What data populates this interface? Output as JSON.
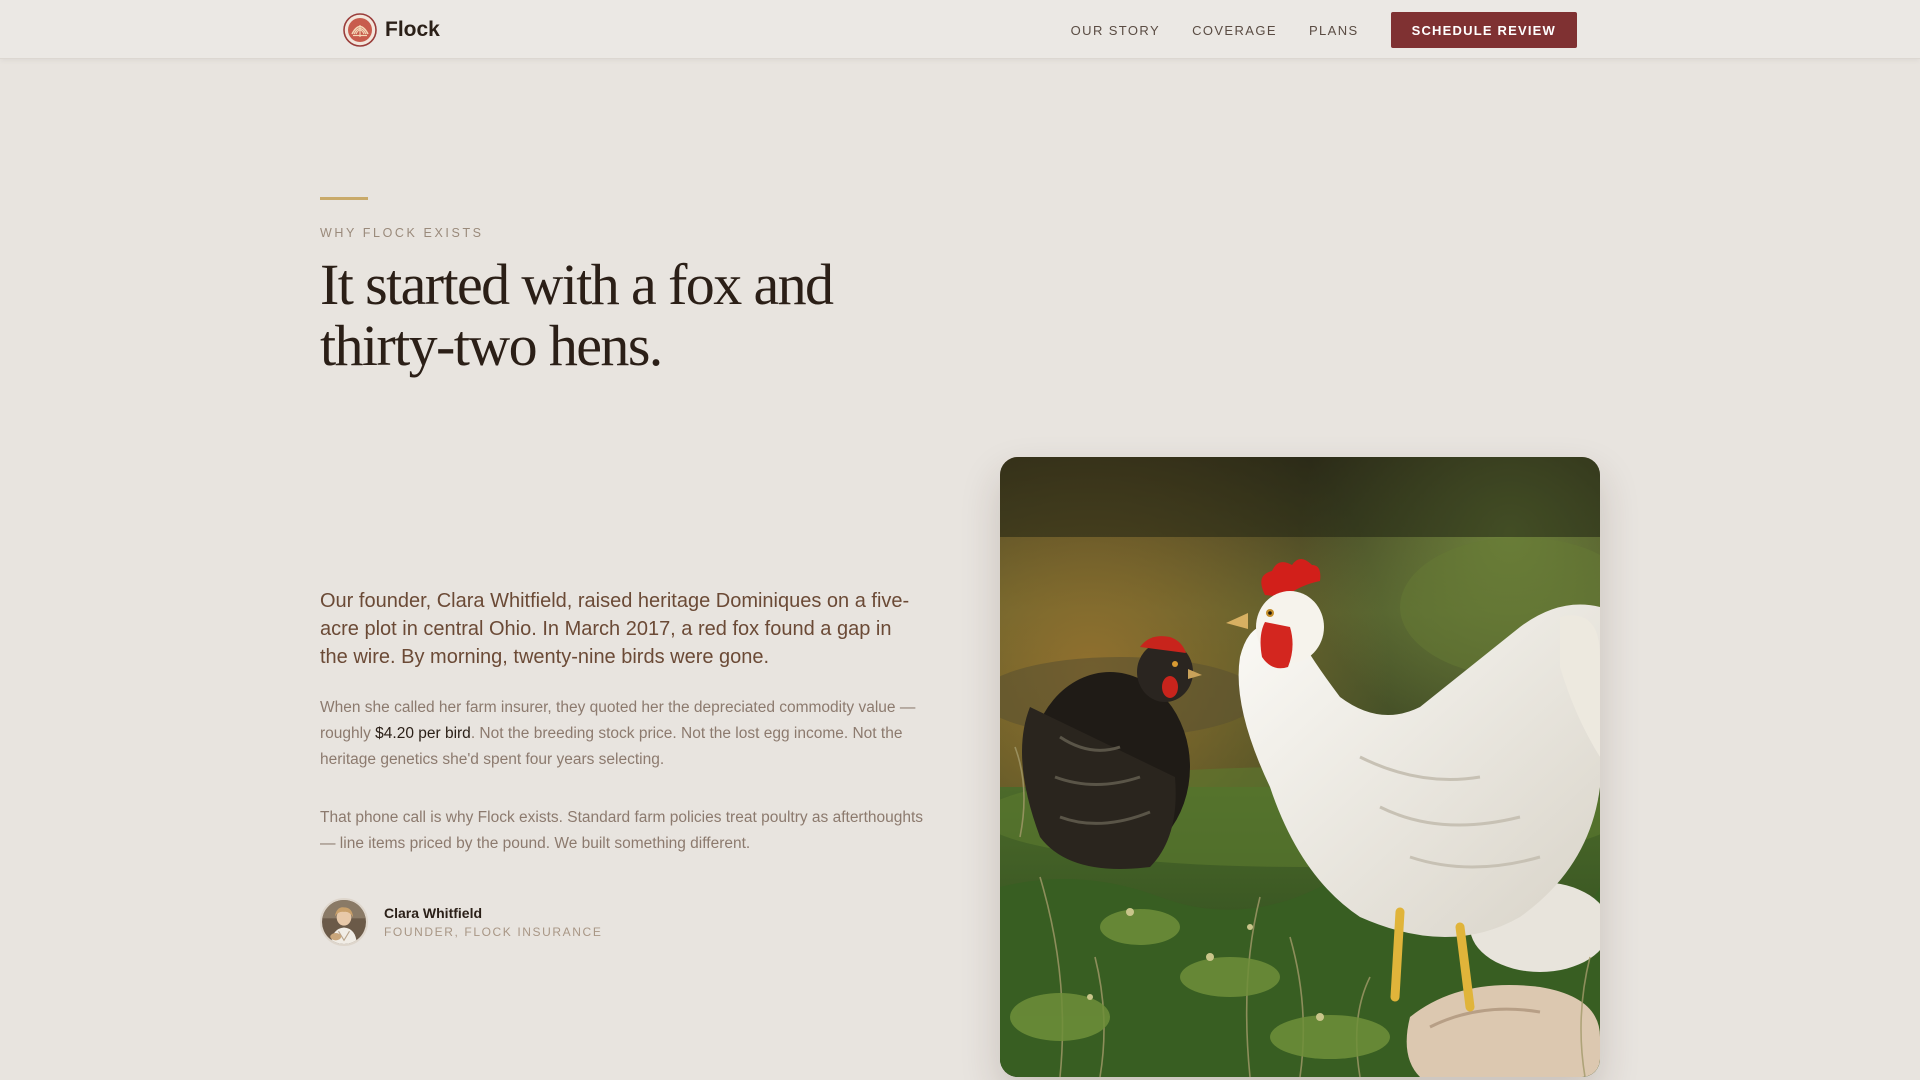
{
  "header": {
    "brand_name": "Flock",
    "brand_icon": "flock-logo-icon",
    "nav": [
      {
        "label": "OUR STORY"
      },
      {
        "label": "COVERAGE"
      },
      {
        "label": "PLANS"
      }
    ],
    "cta_label": "SCHEDULE REVIEW"
  },
  "hero": {
    "eyebrow": "WHY FLOCK EXISTS",
    "headline_line1": "It started with a fox and",
    "headline_line2": "thirty-two hens.",
    "lead": "Our founder, Clara Whitfield, raised heritage Dominiques on a five-acre plot in central Ohio. In March 2017, a red fox found a gap in the wire. By morning, twenty-nine birds were gone.",
    "p1_before": "When she called her farm insurer, they quoted her the depreciated commodity value — roughly ",
    "p1_emphasis": "$4.20 per bird",
    "p1_after": ". Not the breeding stock price. Not the lost egg income. Not the heritage genetics she'd spent four years selecting.",
    "p2": "That phone call is why Flock exists. Standard farm policies treat poultry as afterthoughts — line items priced by the pound. We built something different.",
    "author_name": "Clara Whitfield",
    "author_role": "FOUNDER, FLOCK INSURANCE"
  },
  "colors": {
    "background": "#e8e4df",
    "accent_red": "#7f3132",
    "gold_rule": "#c9aa6a",
    "lead_brown": "#6b4a36"
  }
}
